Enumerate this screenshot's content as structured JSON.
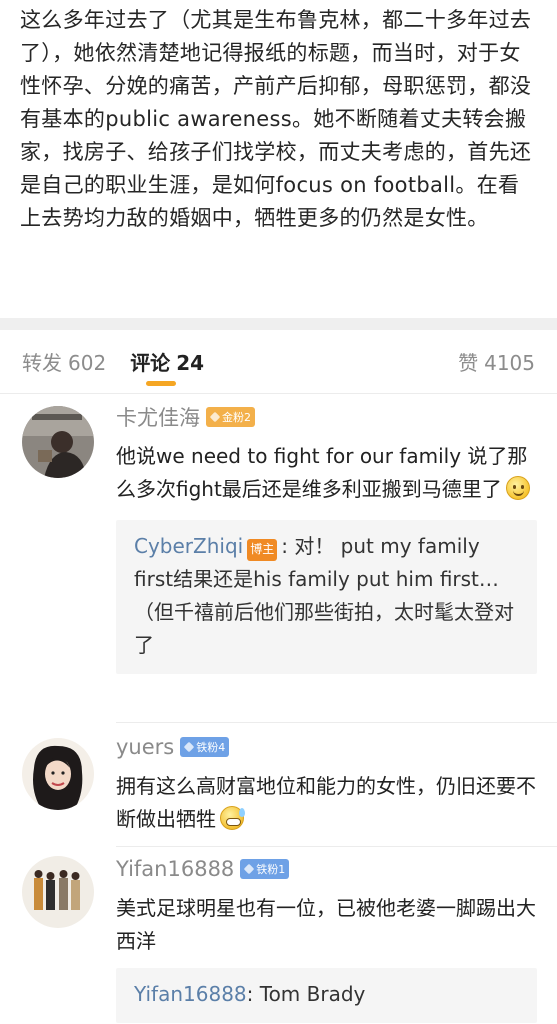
{
  "article": {
    "text": "这么多年过去了（尤其是生布鲁克林，都二十多年过去了），她依然清楚地记得报纸的标题，而当时，对于女性怀孕、分娩的痛苦，产前产后抑郁，母职惩罚，都没有基本的public awareness。她不断随着丈夫转会搬家，找房子、给孩子们找学校，而丈夫考虑的，首先还是自己的职业生涯，是如何focus on football。在看上去势均力敌的婚姻中，牺牲更多的仍然是女性。"
  },
  "tabs": {
    "repost_label": "转发",
    "repost_count": "602",
    "comment_label": "评论",
    "comment_count": "24",
    "like_label": "赞",
    "like_count": "4105",
    "accent_color": "#f5a623"
  },
  "comments": [
    {
      "username": "卡尤佳海",
      "badge": "金粉2",
      "text": "他说we need to fight for our family 说了那么多次fight最后还是维多利亚搬到马德里了",
      "emoji": "smile-emoji",
      "reply": {
        "username": "CyberZhiqi",
        "role_badge": "博主",
        "text": ": 对！ put my family first结果还是his family put him first…（但千禧前后他们那些街拍，太时髦太登对了"
      }
    },
    {
      "username": "yuers",
      "badge": "铁粉4",
      "text": "拥有这么高财富地位和能力的女性，仍旧还要不断做出牺牲",
      "emoji": "sweat-smile-emoji"
    },
    {
      "username": "Yifan16888",
      "badge": "铁粉1",
      "text": "美式足球明星也有一位，已被他老婆一脚踢出大西洋",
      "reply": {
        "username": "Yifan16888",
        "text": ": Tom Brady"
      }
    }
  ],
  "colors": {
    "link_blue": "#5b7fa8",
    "gold_badge": "#f3b04a",
    "iron_badge": "#6ea1e6",
    "author_badge": "#f08a24"
  }
}
